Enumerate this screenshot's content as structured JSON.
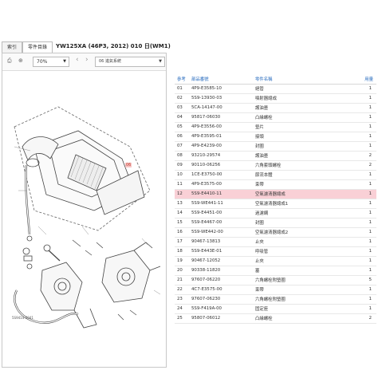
{
  "tabs": [
    {
      "label": "索引"
    },
    {
      "label": "零件目錄"
    }
  ],
  "document_title": "YW125XA (46P3, 2012) 010 日(WM1)",
  "toolbar": {
    "zoom_value": "70%",
    "section_value": "06 進氣系統"
  },
  "diagram": {
    "code_label": "5S9414-0041",
    "tag_label": "06"
  },
  "table": {
    "headers": {
      "ref": "參考",
      "part_no": "部品番號",
      "name": "零件名稱",
      "qty": "用量"
    },
    "rows": [
      {
        "ref": "01",
        "part_no": "4P9-E3585-10",
        "name": "絕管",
        "qty": "1"
      },
      {
        "ref": "02",
        "part_no": "5S9-13930-03",
        "name": "噴射器總成",
        "qty": "1"
      },
      {
        "ref": "03",
        "part_no": "5CA-14147-00",
        "name": "護油墨",
        "qty": "1"
      },
      {
        "ref": "04",
        "part_no": "95817-06030",
        "name": "凸緣螺栓",
        "qty": "1"
      },
      {
        "ref": "05",
        "part_no": "4P9-E3556-00",
        "name": "墊片",
        "qty": "1"
      },
      {
        "ref": "06",
        "part_no": "4P9-E3595-01",
        "name": "接頭",
        "qty": "1"
      },
      {
        "ref": "07",
        "part_no": "4P9-E4239-00",
        "name": "封圈",
        "qty": "1"
      },
      {
        "ref": "08",
        "part_no": "93210-29574",
        "name": "護油墨",
        "qty": "2"
      },
      {
        "ref": "09",
        "part_no": "90110-06256",
        "name": "六角套頭螺栓",
        "qty": "2"
      },
      {
        "ref": "10",
        "part_no": "1CE-E3750-00",
        "name": "節流本體",
        "qty": "1"
      },
      {
        "ref": "11",
        "part_no": "4P9-E3575-00",
        "name": "束帶",
        "qty": "1"
      },
      {
        "ref": "12",
        "part_no": "5S9-E4410-11",
        "name": "空氣濾清器總成",
        "qty": "1",
        "selected": true
      },
      {
        "ref": "13",
        "part_no": "5S9-WE441-11",
        "name": "空氣濾清器總成1",
        "qty": "1"
      },
      {
        "ref": "14",
        "part_no": "5S9-E4451-00",
        "name": "過濾網",
        "qty": "1"
      },
      {
        "ref": "15",
        "part_no": "5S9-E4467-00",
        "name": "封圈",
        "qty": "1"
      },
      {
        "ref": "16",
        "part_no": "5S9-WE442-00",
        "name": "空氣濾清器總成2",
        "qty": "1"
      },
      {
        "ref": "17",
        "part_no": "90467-13813",
        "name": "止夾",
        "qty": "1"
      },
      {
        "ref": "18",
        "part_no": "5S9-E443E-01",
        "name": "呼吸管",
        "qty": "1"
      },
      {
        "ref": "19",
        "part_no": "90467-12052",
        "name": "止夾",
        "qty": "1"
      },
      {
        "ref": "20",
        "part_no": "90338-11820",
        "name": "塞",
        "qty": "1"
      },
      {
        "ref": "21",
        "part_no": "97607-06220",
        "name": "六角螺栓附墊圈",
        "qty": "5"
      },
      {
        "ref": "22",
        "part_no": "4C7-E3575-00",
        "name": "束帶",
        "qty": "1"
      },
      {
        "ref": "23",
        "part_no": "97607-06230",
        "name": "六角螺栓附墊圈",
        "qty": "1"
      },
      {
        "ref": "24",
        "part_no": "5S9-F419A-00",
        "name": "固定座",
        "qty": "1"
      },
      {
        "ref": "25",
        "part_no": "95807-06012",
        "name": "凸緣螺栓",
        "qty": "2"
      }
    ]
  }
}
